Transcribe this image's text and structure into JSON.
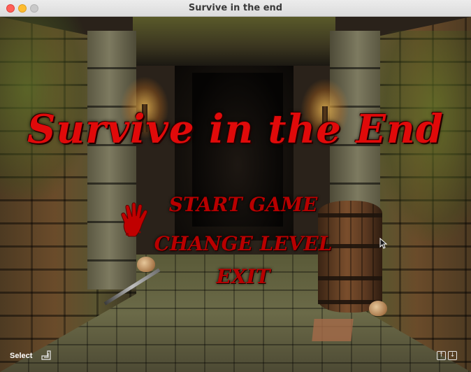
{
  "window": {
    "title": "Survive in the end"
  },
  "game": {
    "title": "Survive in the End",
    "menu": {
      "items": [
        {
          "label": "START GAME",
          "selected": true
        },
        {
          "label": "CHANGE LEVEL",
          "selected": false
        },
        {
          "label": "EXIT",
          "selected": false
        }
      ],
      "selector_icon": "bloody-hand-icon"
    },
    "hud": {
      "select_label": "Select",
      "select_icon": "enter-key-icon",
      "nav_icons": [
        "arrow-up-key-icon",
        "arrow-down-key-icon"
      ]
    }
  },
  "colors": {
    "title_red": "#e00a0a",
    "menu_red": "#b80000"
  }
}
